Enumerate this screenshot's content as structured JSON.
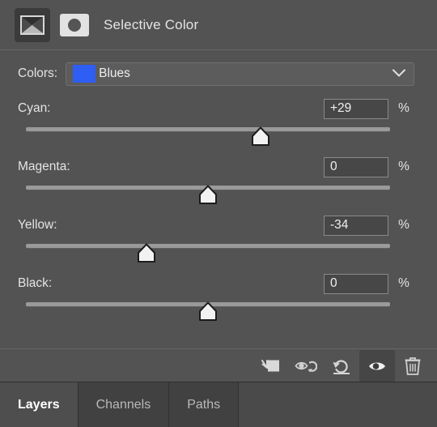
{
  "header": {
    "title": "Selective Color",
    "adjustment_icon": "selective-color-adjustment-icon",
    "mask_icon": "layer-mask-icon"
  },
  "colors": {
    "label": "Colors:",
    "selected": "Blues",
    "swatch_color": "#2f5ef5",
    "dropdown_icon": "chevron-down-icon"
  },
  "sliders": [
    {
      "label": "Cyan:",
      "value": "+29",
      "unit": "%",
      "percent": 29
    },
    {
      "label": "Magenta:",
      "value": "0",
      "unit": "%",
      "percent": 0
    },
    {
      "label": "Yellow:",
      "value": "-34",
      "unit": "%",
      "percent": -34
    },
    {
      "label": "Black:",
      "value": "0",
      "unit": "%",
      "percent": 0
    }
  ],
  "toolbar": {
    "buttons": [
      {
        "name": "clip-to-layer-icon",
        "title": "Clip to layer",
        "active": false
      },
      {
        "name": "toggle-previous-state-icon",
        "title": "Toggle previous state",
        "active": false
      },
      {
        "name": "reset-adjustment-icon",
        "title": "Reset to defaults",
        "active": false
      },
      {
        "name": "toggle-visibility-icon",
        "title": "Toggle layer visibility",
        "active": true
      },
      {
        "name": "delete-layer-icon",
        "title": "Delete adjustment layer",
        "active": false
      }
    ]
  },
  "tabs": [
    {
      "label": "Layers",
      "active": true
    },
    {
      "label": "Channels",
      "active": false
    },
    {
      "label": "Paths",
      "active": false
    }
  ]
}
